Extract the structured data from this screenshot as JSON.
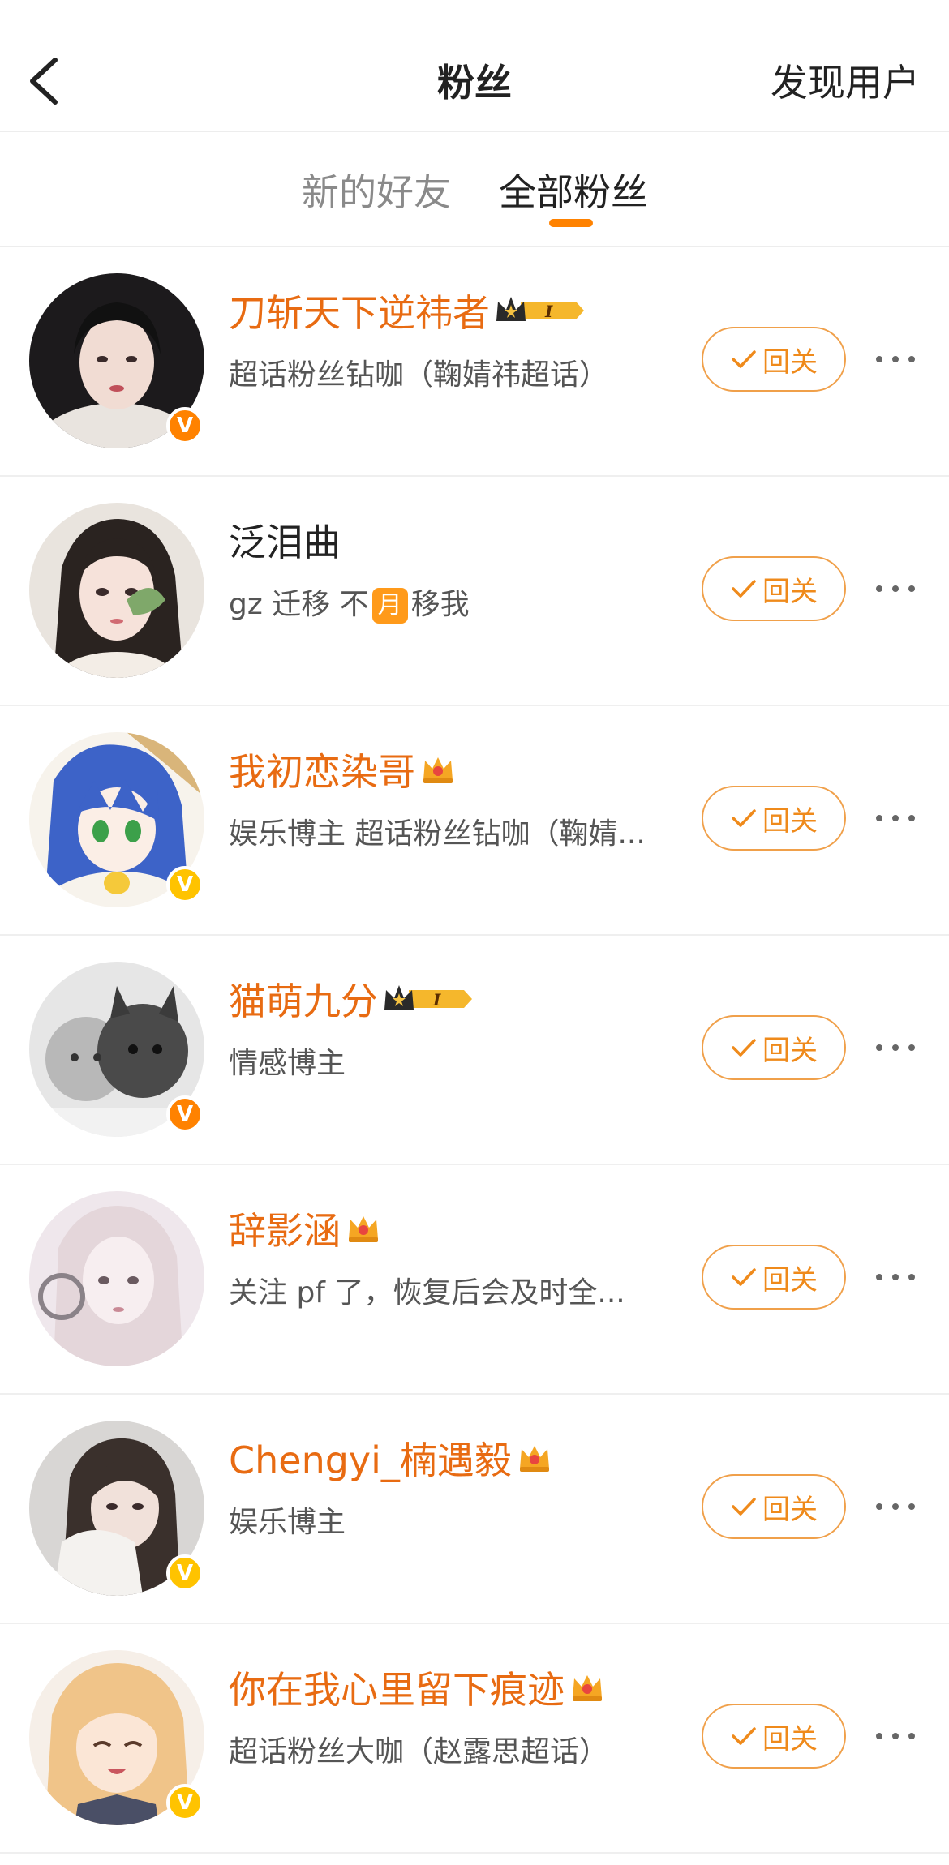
{
  "header": {
    "title": "粉丝",
    "discover_label": "发现用户"
  },
  "tabs": [
    {
      "label": "新的好友",
      "active": false
    },
    {
      "label": "全部粉丝",
      "active": true
    }
  ],
  "accent_color": "#ff8200",
  "users": [
    {
      "name": "刀斩天下逆祎者",
      "name_color": "orange",
      "crown": "level-crown",
      "crown_level": "I",
      "desc": "超话粉丝钻咖（鞠婧祎超话）",
      "verified": "orange",
      "follow_label": "回关"
    },
    {
      "name": "泛泪曲",
      "name_color": "plain",
      "crown": "",
      "desc_before": "gz 迁移 不",
      "desc_badge": "月",
      "desc_after": "移我",
      "verified": "",
      "follow_label": "回关"
    },
    {
      "name": "我初恋染哥",
      "name_color": "orange",
      "crown": "vip-crown",
      "desc": "娱乐博主 超话粉丝钻咖（鞠婧...",
      "verified": "yellow",
      "follow_label": "回关"
    },
    {
      "name": "猫萌九分",
      "name_color": "orange",
      "crown": "level-crown",
      "crown_level": "I",
      "desc": "情感博主",
      "verified": "orange",
      "follow_label": "回关"
    },
    {
      "name": "辞影涵",
      "name_color": "orange",
      "crown": "vip-crown",
      "desc": "关注 pf 了，恢复后会及时全...",
      "verified": "",
      "follow_label": "回关"
    },
    {
      "name": "Chengyi_楠遇毅",
      "name_color": "orange",
      "crown": "vip-crown",
      "desc": "娱乐博主",
      "verified": "yellow",
      "follow_label": "回关"
    },
    {
      "name": "你在我心里留下痕迹",
      "name_color": "orange",
      "crown": "vip-crown",
      "desc": "超话粉丝大咖（赵露思超话）",
      "verified": "yellow",
      "follow_label": "回关"
    }
  ],
  "verified_badge_letter": "V"
}
